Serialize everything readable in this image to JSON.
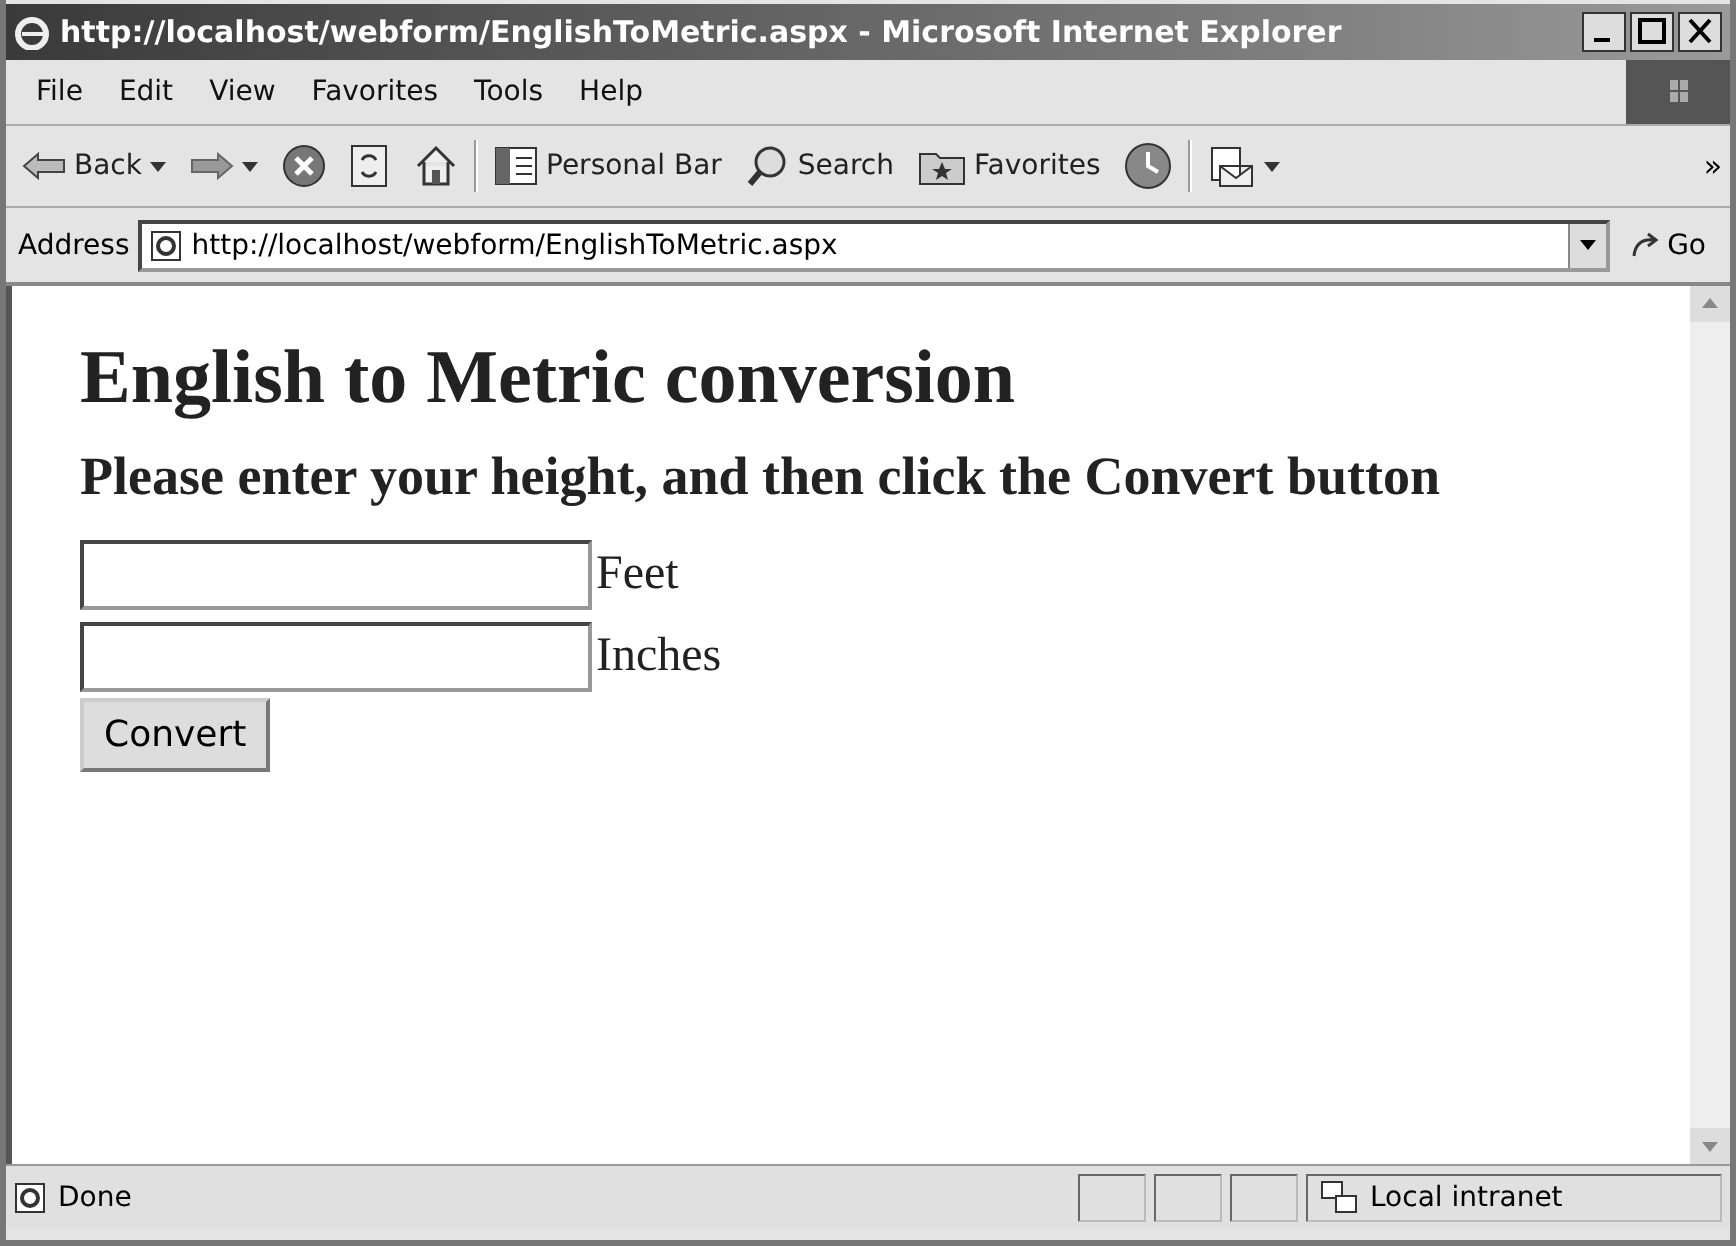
{
  "window": {
    "title": "http://localhost/webform/EnglishToMetric.aspx - Microsoft Internet Explorer"
  },
  "menu": [
    "File",
    "Edit",
    "View",
    "Favorites",
    "Tools",
    "Help"
  ],
  "toolbar": [
    {
      "kind": "back",
      "label": "Back",
      "dropdown": true
    },
    {
      "kind": "forward",
      "dropdown": true
    },
    {
      "kind": "stop",
      "dropdown": false
    },
    {
      "kind": "refresh",
      "dropdown": false
    },
    {
      "kind": "home",
      "dropdown": false
    },
    {
      "kind": "personal",
      "label": "Personal Bar",
      "dropdown": false
    },
    {
      "kind": "search",
      "label": "Search",
      "dropdown": false
    },
    {
      "kind": "favorites",
      "label": "Favorites",
      "dropdown": false
    },
    {
      "kind": "history",
      "dropdown": false
    },
    {
      "kind": "mail",
      "dropdown": true
    }
  ],
  "toolbar_more": "»",
  "address": {
    "label": "Address",
    "value": "http://localhost/webform/EnglishToMetric.aspx",
    "go": "Go"
  },
  "page": {
    "heading": "English to Metric conversion",
    "subheading": "Please enter your height, and then click the Convert button",
    "fields": [
      {
        "label": "Feet"
      },
      {
        "label": "Inches"
      }
    ],
    "button": "Convert"
  },
  "status_bar": {
    "text": "Done",
    "zone": "Local intranet"
  }
}
